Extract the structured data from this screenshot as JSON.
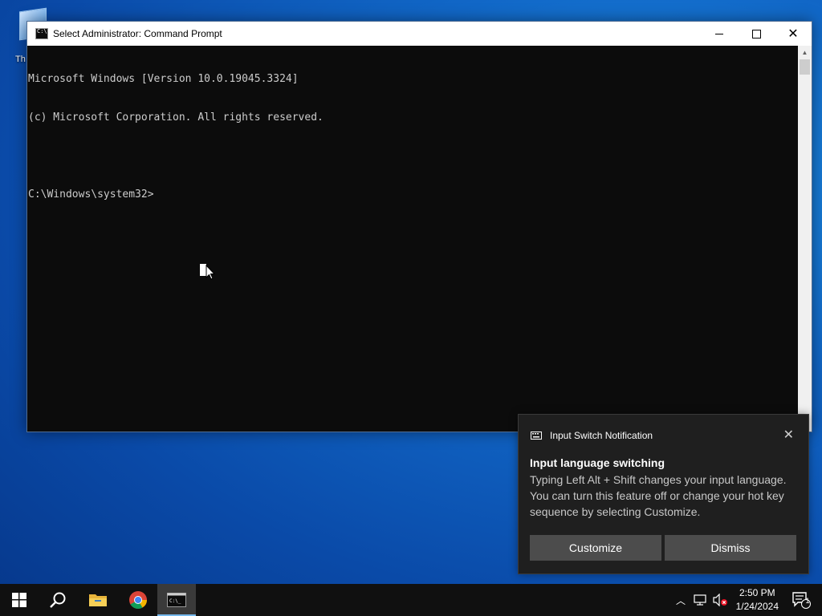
{
  "desktop": {
    "icon_label": "Th"
  },
  "window": {
    "title": "Select Administrator: Command Prompt",
    "console_lines": [
      "Microsoft Windows [Version 10.0.19045.3324]",
      "(c) Microsoft Corporation. All rights reserved.",
      "",
      "C:\\Windows\\system32>"
    ]
  },
  "notification": {
    "app_name": "Input Switch Notification",
    "title": "Input language switching",
    "body": "Typing Left Alt + Shift changes your input language. You can turn this feature off or change your hot key sequence by selecting Customize.",
    "buttons": {
      "customize": "Customize",
      "dismiss": "Dismiss"
    }
  },
  "taskbar": {
    "clock_time": "2:50 PM",
    "clock_date": "1/24/2024",
    "notification_count": "1",
    "accent_color": "#76b9ed"
  },
  "colors": {
    "console_bg": "#0c0c0c",
    "console_text": "#cccccc",
    "toast_bg": "#1f1f1f",
    "taskbar_bg": "#101010"
  }
}
